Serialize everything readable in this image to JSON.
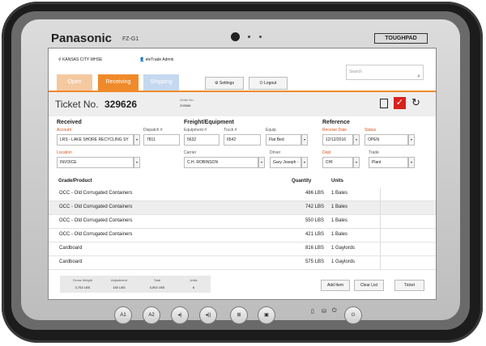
{
  "device": {
    "brand": "Panasonic",
    "model": "FZ-G1",
    "tag": "TOUGHPAD"
  },
  "header": {
    "location": "KANSAS CITY WHSE",
    "user": "eleTrade Admin",
    "search_placeholder": "Search"
  },
  "tabs": [
    {
      "label": "Open"
    },
    {
      "label": "Receiving"
    },
    {
      "label": "Shipping"
    }
  ],
  "toolbar": {
    "settings": "Settings",
    "logout": "Logout"
  },
  "ticket": {
    "label": "Ticket No.",
    "number": "329626",
    "order_label": "Order No.",
    "order_value": "205568"
  },
  "received": {
    "title": "Received",
    "account_label": "Account",
    "account_value": "LRS - LAKE SHORE RECYCLING SY",
    "dispatch_label": "Dispatch #",
    "dispatch_value": "7811",
    "location_label": "Location",
    "location_value": "INVOICE"
  },
  "freight": {
    "title": "Freight/Equipment",
    "equipment_label": "Equipment #",
    "equipment_value": "5632",
    "truck_label": "Truck #",
    "truck_value": "6542",
    "equip_label": "Equip",
    "equip_value": "Flat Bed",
    "carrier_label": "Carrier",
    "carrier_value": "C.H. ROBINSON",
    "driver_label": "Driver",
    "driver_value": "Gary Joseph -"
  },
  "reference": {
    "title": "Reference",
    "receive_date_label": "Receive Date",
    "receive_date_value": "12/12/2016",
    "status_label": "Status",
    "status_value": "OPEN",
    "dept_label": "Dept",
    "dept_value": "CHI",
    "trade_label": "Trade",
    "trade_value": "Plant"
  },
  "grid": {
    "headers": {
      "product": "Grade/Product",
      "quantity": "Quantity",
      "units": "Units"
    },
    "rows": [
      {
        "product": "OCC - Old Corrugated Containers",
        "quantity": "486 LBS",
        "units": "1 Bales"
      },
      {
        "product": "OCC - Old Corrugated Containers",
        "quantity": "742 LBS",
        "units": "1 Bales"
      },
      {
        "product": "OCC - Old Corrugated Containers",
        "quantity": "550 LBS",
        "units": "1 Bales"
      },
      {
        "product": "OCC - Old Corrugated Containers",
        "quantity": "421 LBS",
        "units": "1 Bales"
      },
      {
        "product": "Cardboard",
        "quantity": "816 LBS",
        "units": "1 Gaylords"
      },
      {
        "product": "Cardboard",
        "quantity": "575 LBS",
        "units": "1 Gaylords"
      }
    ]
  },
  "totals": {
    "gross_label": "Gross Weight",
    "gross_value": "3,752 LBS",
    "adjust_label": "Adjustment",
    "adjust_value": "160 LBS",
    "total_label": "Total",
    "total_value": "3,592 LBS",
    "units_label": "Units",
    "units_value": "6"
  },
  "actions": {
    "add_item": "Add Item",
    "clear_list": "Clear List",
    "ticket": "Ticket"
  },
  "hardware_buttons": [
    "A1",
    "A2"
  ],
  "colors": {
    "accent": "#ef8a2a",
    "danger": "#d7221f",
    "shipping_tab": "#c5d8f0"
  }
}
